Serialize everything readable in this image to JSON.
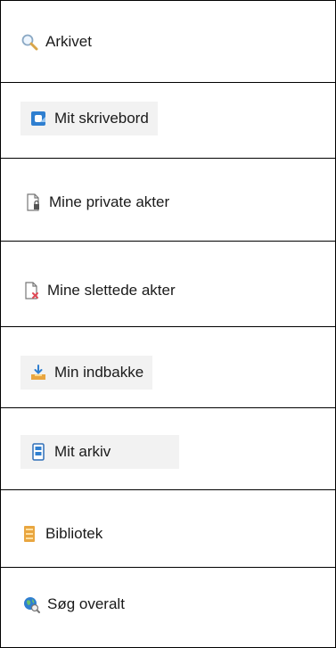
{
  "menu": {
    "items": [
      {
        "label": "Arkivet",
        "icon": "search-icon"
      },
      {
        "label": "Mit skrivebord",
        "icon": "desktop-icon"
      },
      {
        "label": "Mine private akter",
        "icon": "private-document-icon"
      },
      {
        "label": "Mine slettede akter",
        "icon": "deleted-document-icon"
      },
      {
        "label": "Min indbakke",
        "icon": "inbox-icon"
      },
      {
        "label": "Mit arkiv",
        "icon": "archive-icon"
      },
      {
        "label": "Bibliotek",
        "icon": "library-icon"
      },
      {
        "label": "Søg overalt",
        "icon": "global-search-icon"
      }
    ]
  },
  "colors": {
    "border": "#000000",
    "highlight": "#f2f2f2",
    "text": "#1a1a1a",
    "accent_blue": "#2f7fd0",
    "accent_orange": "#e9a640",
    "accent_red": "#e04a56"
  }
}
